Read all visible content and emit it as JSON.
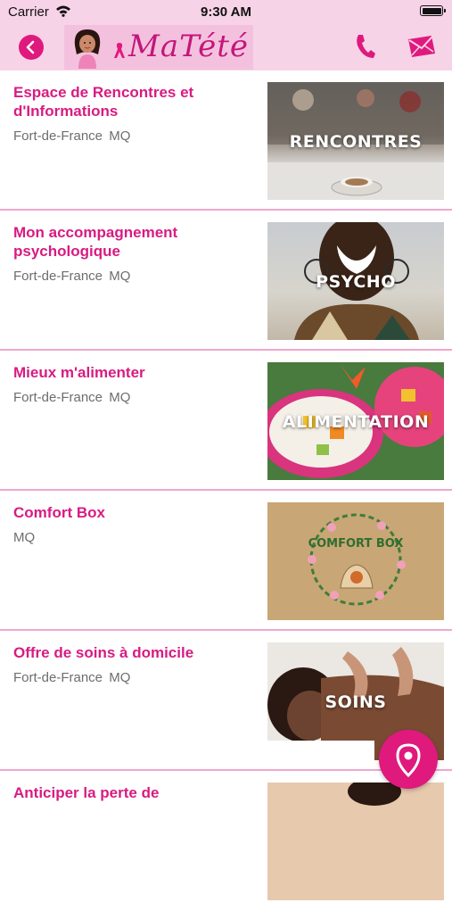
{
  "status_bar": {
    "carrier": "Carrier",
    "time": "9:30 AM"
  },
  "header": {
    "logo_text": "MaTété",
    "back_icon": "chevron-left-icon",
    "phone_icon": "phone-icon",
    "mail_icon": "mail-icon"
  },
  "colors": {
    "accent": "#e0197d",
    "title": "#d81b82",
    "header_bg": "#f7d3e8",
    "divider": "#f0a7cf"
  },
  "items": [
    {
      "title": "Espace de Rencontres et d'Informations",
      "location": "Fort-de-France  MQ",
      "image_label": "RENCONTRES"
    },
    {
      "title": "Mon accompagnement psychologique",
      "location": "Fort-de-France  MQ",
      "image_label": "PSYCHO"
    },
    {
      "title": "Mieux m'alimenter",
      "location": "Fort-de-France  MQ",
      "image_label": "ALIMENTATION"
    },
    {
      "title": "Comfort Box",
      "location": "MQ",
      "image_label": "COMFORT BOX"
    },
    {
      "title": "Offre de soins à domicile",
      "location": "Fort-de-France  MQ",
      "image_label": "SOINS"
    },
    {
      "title": "Anticiper la perte de",
      "location": "",
      "image_label": ""
    }
  ],
  "map_button_icon": "location-pin-icon"
}
